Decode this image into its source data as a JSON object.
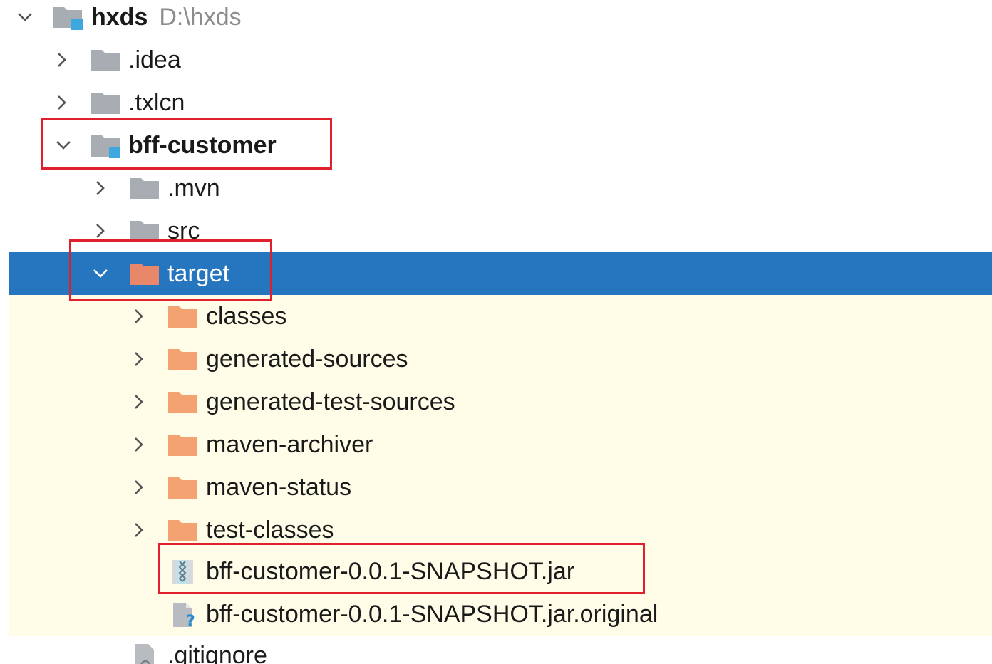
{
  "colors": {
    "selection": "#2675bf",
    "excluded_band": "#fffde8",
    "gray_folder": "#a8adb3",
    "excluded_folder": "#f4a271",
    "selected_folder": "#e8876a",
    "module_badge": "#3ea7e0",
    "highlight_box": "#e0202c"
  },
  "tree": {
    "root": {
      "name": "hxds",
      "path": "D:\\hxds"
    },
    "items": [
      {
        "label": ".idea"
      },
      {
        "label": ".txlcn"
      },
      {
        "label": "bff-customer"
      },
      {
        "label": ".mvn"
      },
      {
        "label": "src"
      },
      {
        "label": "target"
      },
      {
        "label": "classes"
      },
      {
        "label": "generated-sources"
      },
      {
        "label": "generated-test-sources"
      },
      {
        "label": "maven-archiver"
      },
      {
        "label": "maven-status"
      },
      {
        "label": "test-classes"
      },
      {
        "label": "bff-customer-0.0.1-SNAPSHOT.jar"
      },
      {
        "label": "bff-customer-0.0.1-SNAPSHOT.jar.original"
      },
      {
        "label": ".gitignore"
      }
    ]
  }
}
